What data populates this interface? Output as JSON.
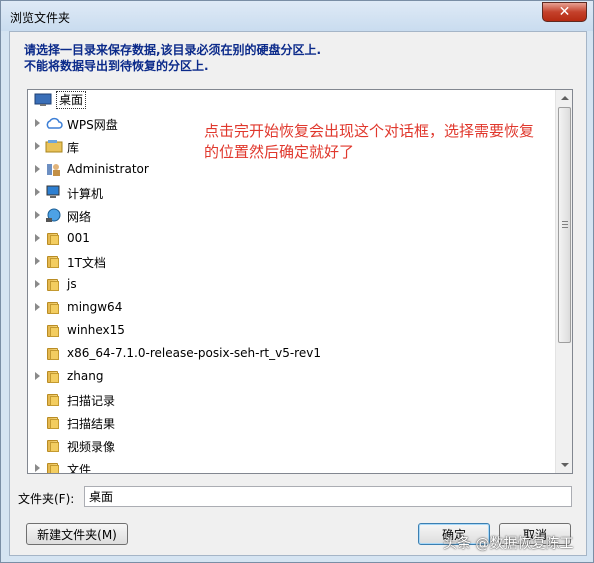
{
  "window": {
    "title": "浏览文件夹"
  },
  "instruction": {
    "line1": "请选择一目录来保存数据,该目录必须在别的硬盘分区上.",
    "line2": "不能将数据导出到待恢复的分区上."
  },
  "tree": {
    "items": [
      {
        "label": "桌面",
        "icon": "desktop-icon",
        "expandable": false,
        "selected": true,
        "indent": 0
      },
      {
        "label": "WPS网盘",
        "icon": "cloud-icon",
        "expandable": true,
        "indent": 1
      },
      {
        "label": "库",
        "icon": "library-icon",
        "expandable": true,
        "indent": 1
      },
      {
        "label": "Administrator",
        "icon": "user-icon",
        "expandable": true,
        "indent": 1
      },
      {
        "label": "计算机",
        "icon": "computer-icon",
        "expandable": true,
        "indent": 1
      },
      {
        "label": "网络",
        "icon": "network-icon",
        "expandable": true,
        "indent": 1
      },
      {
        "label": "001",
        "icon": "folder-icon",
        "expandable": true,
        "indent": 1
      },
      {
        "label": "1T文档",
        "icon": "folder-icon",
        "expandable": true,
        "indent": 1
      },
      {
        "label": "js",
        "icon": "folder-icon",
        "expandable": true,
        "indent": 1
      },
      {
        "label": "mingw64",
        "icon": "folder-icon",
        "expandable": true,
        "indent": 1
      },
      {
        "label": "winhex15",
        "icon": "folder-icon",
        "expandable": false,
        "indent": 1
      },
      {
        "label": "x86_64-7.1.0-release-posix-seh-rt_v5-rev1",
        "icon": "folder-icon",
        "expandable": false,
        "indent": 1
      },
      {
        "label": "zhang",
        "icon": "folder-icon",
        "expandable": true,
        "indent": 1
      },
      {
        "label": "扫描记录",
        "icon": "folder-icon",
        "expandable": false,
        "indent": 1
      },
      {
        "label": "扫描结果",
        "icon": "folder-icon",
        "expandable": false,
        "indent": 1
      },
      {
        "label": "视频录像",
        "icon": "folder-icon",
        "expandable": false,
        "indent": 1
      },
      {
        "label": "文件",
        "icon": "folder-icon",
        "expandable": true,
        "indent": 1
      }
    ]
  },
  "overlay_note": "点击完开始恢复会出现这个对话框，选择需要恢复的位置然后确定就好了",
  "folder_field": {
    "label": "文件夹(F):",
    "value": "桌面"
  },
  "buttons": {
    "new_folder": "新建文件夹(M)",
    "ok": "确定",
    "cancel": "取消"
  },
  "watermark": "头条 @数据恢复陈工",
  "colors": {
    "instruction": "#0b2a8a",
    "note": "#e0382d",
    "dialog_bg": "#f0f0f0"
  }
}
